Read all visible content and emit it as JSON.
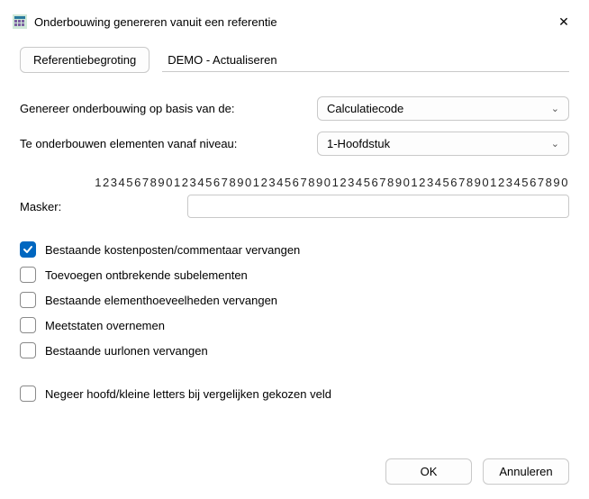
{
  "window": {
    "title": "Onderbouwing genereren vanuit een referentie"
  },
  "reference": {
    "button_label": "Referentiebegroting",
    "value": "DEMO - Actualiseren"
  },
  "basis": {
    "label": "Genereer onderbouwing op basis van de:",
    "selected": "Calculatiecode"
  },
  "level": {
    "label": "Te onderbouwen elementen vanaf niveau:",
    "selected": "1-Hoofdstuk"
  },
  "mask": {
    "label": "Masker:",
    "ruler": "123456789012345678901234567890123456789012345678901234567890",
    "value": ""
  },
  "checks": [
    {
      "key": "replace_costposts",
      "label": "Bestaande kostenposten/commentaar vervangen",
      "checked": true
    },
    {
      "key": "add_missing",
      "label": "Toevoegen ontbrekende subelementen",
      "checked": false
    },
    {
      "key": "replace_qty",
      "label": "Bestaande elementhoeveelheden vervangen",
      "checked": false
    },
    {
      "key": "take_measurements",
      "label": "Meetstaten overnemen",
      "checked": false
    },
    {
      "key": "replace_wages",
      "label": "Bestaande uurlonen vervangen",
      "checked": false
    },
    {
      "key": "ignore_case",
      "label": "Negeer hoofd/kleine letters bij vergelijken gekozen veld",
      "checked": false
    }
  ],
  "buttons": {
    "ok": "OK",
    "cancel": "Annuleren"
  }
}
